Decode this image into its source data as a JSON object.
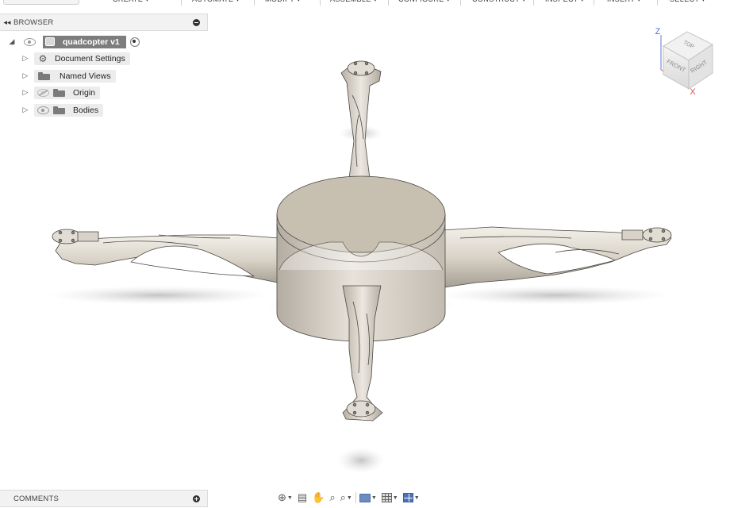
{
  "toolbar": {
    "menus": [
      "CREATE ▾",
      "AUTOMATE ▾",
      "MODIFY ▾",
      "ASSEMBLE ▾",
      "CONFIGURE ▾",
      "CONSTRUCT ▾",
      "INSPECT ▾",
      "INSERT ▾",
      "SELECT ▾"
    ]
  },
  "browser": {
    "collapse_glyph": "◂◂",
    "title": "BROWSER",
    "root": {
      "label": "quadcopter v1"
    },
    "items": [
      {
        "label": "Document Settings",
        "icon": "gear-icon"
      },
      {
        "label": "Named Views",
        "icon": "folder-icon"
      },
      {
        "label": "Origin",
        "icon": "folder-icon",
        "visibility": "hidden"
      },
      {
        "label": "Bodies",
        "icon": "folder-icon",
        "visibility": "visible"
      }
    ]
  },
  "comments": {
    "title": "COMMENTS"
  },
  "viewcube": {
    "face_top": "TOP",
    "face_front": "FRONT",
    "face_right": "RIGHT",
    "axis_z": "Z",
    "axis_x": "X"
  },
  "nav_toolbar": {
    "tools": [
      "orbit-icon",
      "look-at-icon",
      "pan-icon",
      "zoom-icon",
      "fit-icon",
      "display-settings-icon",
      "grid-settings-icon",
      "viewports-icon"
    ]
  },
  "colors": {
    "model_body": "#d6d0c5",
    "model_top": "#c9c0b0",
    "accent_blue": "#4d72b5",
    "axis_z": "#5b6fd6",
    "axis_x": "#e05050"
  }
}
